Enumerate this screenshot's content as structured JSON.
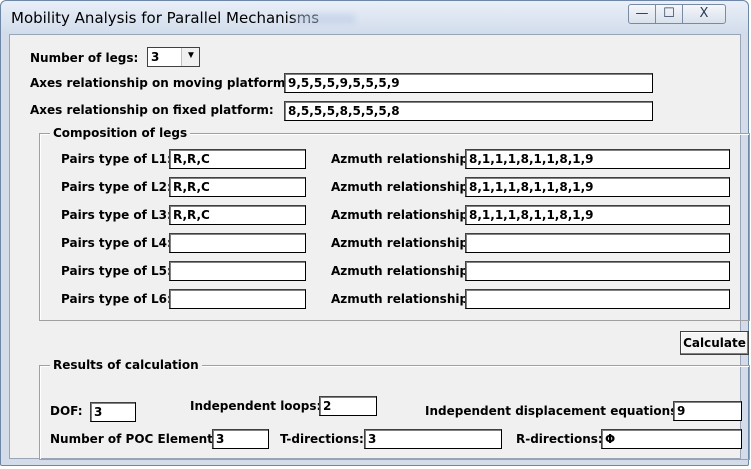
{
  "window": {
    "title": "Mobility Analysis for Parallel Mechanisms",
    "controls": {
      "minimize": "—",
      "maximize": "☐",
      "close": "X"
    }
  },
  "legs_count": {
    "label": "Number of legs:",
    "value": "3",
    "dropdown_icon": "chevron-down-icon"
  },
  "axes": {
    "moving_label": "Axes relationship on moving platform:",
    "moving_value": "9,5,5,5,9,5,5,5,9",
    "fixed_label": "Axes relationship on fixed platform:",
    "fixed_value": "8,5,5,5,8,5,5,5,8"
  },
  "composition": {
    "title": "Composition of legs",
    "legs": [
      {
        "pairs_label": "Pairs type of L1:",
        "pairs_value": "R,R,C",
        "azmuth_label": "Azmuth relationship:",
        "azmuth_value": "8,1,1,1,8,1,1,8,1,9"
      },
      {
        "pairs_label": "Pairs type of L2:",
        "pairs_value": "R,R,C",
        "azmuth_label": "Azmuth relationship:",
        "azmuth_value": "8,1,1,1,8,1,1,8,1,9"
      },
      {
        "pairs_label": "Pairs type of L3:",
        "pairs_value": "R,R,C",
        "azmuth_label": "Azmuth relationship:",
        "azmuth_value": "8,1,1,1,8,1,1,8,1,9"
      },
      {
        "pairs_label": "Pairs type of L4:",
        "pairs_value": "",
        "azmuth_label": "Azmuth relationship:",
        "azmuth_value": ""
      },
      {
        "pairs_label": "Pairs type of L5:",
        "pairs_value": "",
        "azmuth_label": "Azmuth relationship:",
        "azmuth_value": ""
      },
      {
        "pairs_label": "Pairs type of L6:",
        "pairs_value": "",
        "azmuth_label": "Azmuth relationship:",
        "azmuth_value": ""
      }
    ]
  },
  "calculate_label": "Calculate",
  "results": {
    "title": "Results of calculation",
    "dof_label": "DOF:",
    "dof_value": "3",
    "loops_label": "Independent loops:",
    "loops_value": "2",
    "equations_label": "Independent displacement equations:",
    "equations_value": "9",
    "poc_label": "Number of POC Elements:",
    "poc_value": "3",
    "t_label": "T-directions:",
    "t_value": "3",
    "r_label": "R-directions:",
    "r_value": "Φ"
  }
}
